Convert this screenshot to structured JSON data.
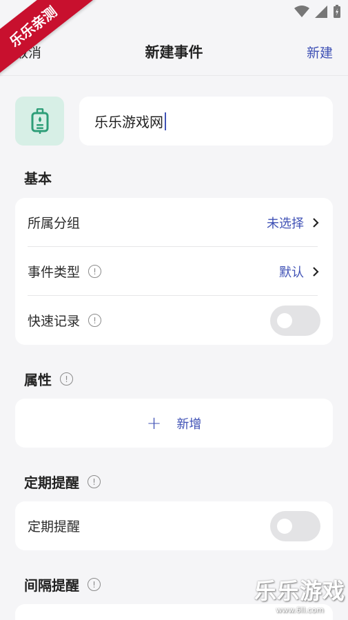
{
  "watermark": {
    "corner": "乐乐亲测",
    "brand": "乐乐游戏",
    "url": "www.6ll.com"
  },
  "header": {
    "cancel": "取消",
    "title": "新建事件",
    "create": "新建"
  },
  "event": {
    "name": "乐乐游戏网",
    "icon": "id-badge-icon"
  },
  "basic": {
    "title": "基本",
    "group_label": "所属分组",
    "group_value": "未选择",
    "type_label": "事件类型",
    "type_value": "默认",
    "quick_label": "快速记录"
  },
  "attributes": {
    "title": "属性",
    "add_label": "新增"
  },
  "periodic": {
    "title": "定期提醒",
    "toggle_label": "定期提醒"
  },
  "interval": {
    "title": "间隔提醒"
  },
  "colors": {
    "accent": "#3f51b5",
    "icon_bg": "#d7efe6",
    "icon_fg": "#2e9e78"
  }
}
